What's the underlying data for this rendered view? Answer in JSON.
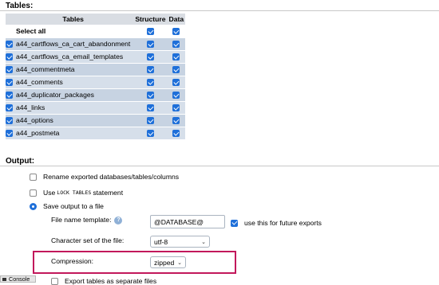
{
  "tables_section": {
    "title": "Tables:",
    "headers": {
      "tables": "Tables",
      "structure": "Structure",
      "data": "Data"
    },
    "select_all_label": "Select all",
    "rows": [
      {
        "name": "a44_cartflows_ca_cart_abandonment",
        "selected": true,
        "structure": true,
        "data": true
      },
      {
        "name": "a44_cartflows_ca_email_templates",
        "selected": true,
        "structure": true,
        "data": true
      },
      {
        "name": "a44_commentmeta",
        "selected": true,
        "structure": true,
        "data": true
      },
      {
        "name": "a44_comments",
        "selected": true,
        "structure": true,
        "data": true
      },
      {
        "name": "a44_duplicator_packages",
        "selected": true,
        "structure": true,
        "data": true
      },
      {
        "name": "a44_links",
        "selected": true,
        "structure": true,
        "data": true
      },
      {
        "name": "a44_options",
        "selected": true,
        "structure": true,
        "data": true
      },
      {
        "name": "a44_postmeta",
        "selected": true,
        "structure": true,
        "data": true
      }
    ]
  },
  "output_section": {
    "title": "Output:",
    "rename_label": "Rename exported databases/tables/columns",
    "use_label_prefix": "Use",
    "lock_tables_code": "LOCK TABLES",
    "use_label_suffix": "statement",
    "save_output_label": "Save output to a file",
    "file_name_template_label": "File name template:",
    "file_name_template_value": "@DATABASE@",
    "future_exports_label": "use this for future exports",
    "charset_label": "Character set of the file:",
    "charset_value": "utf-8",
    "compression_label": "Compression:",
    "compression_value": "zipped",
    "export_separate_label": "Export tables as separate files"
  },
  "console": {
    "label": "Console"
  },
  "colors": {
    "accent": "#1e6fd9",
    "highlight": "#c2185b",
    "row": "#c7d3e2"
  }
}
